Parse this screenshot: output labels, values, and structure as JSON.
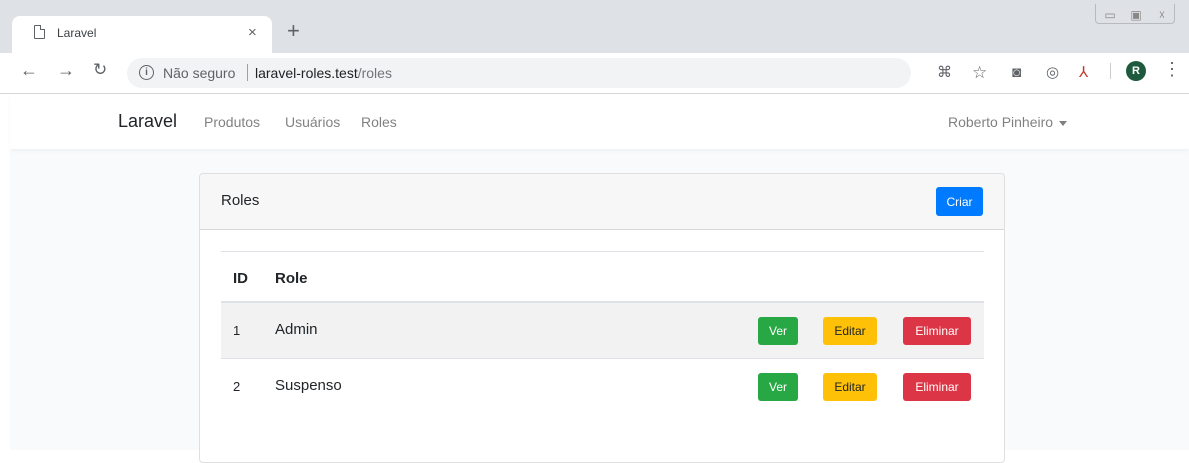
{
  "browser": {
    "tab_title": "Laravel",
    "tab_close": "×",
    "new_tab": "+",
    "security_label": "Não seguro",
    "url_host": "laravel-roles.test",
    "url_path": "/roles",
    "avatar_letter": "R"
  },
  "navbar": {
    "brand": "Laravel",
    "links": [
      "Produtos",
      "Usuários",
      "Roles"
    ],
    "user_name": "Roberto Pinheiro"
  },
  "card": {
    "title": "Roles",
    "create_label": "Criar"
  },
  "table": {
    "headers": [
      "ID",
      "Role"
    ],
    "rows": [
      {
        "id": "1",
        "role": "Admin"
      },
      {
        "id": "2",
        "role": "Suspenso"
      }
    ],
    "actions": {
      "view": "Ver",
      "edit": "Editar",
      "delete": "Eliminar"
    }
  },
  "colors": {
    "primary": "#007bff",
    "success": "#28a745",
    "warning": "#ffc107",
    "danger": "#dc3545"
  }
}
